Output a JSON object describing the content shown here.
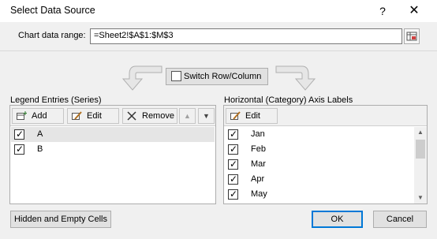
{
  "dialog": {
    "title": "Select Data Source",
    "help_glyph": "?",
    "close_glyph": "✕",
    "chart_range_label": "Chart data range:",
    "chart_range_value": "=Sheet2!$A$1:$M$3",
    "switch_label": "Switch Row/Column",
    "legend": {
      "label": "Legend Entries (Series)",
      "add_label": "Add",
      "edit_label": "Edit",
      "remove_label": "Remove",
      "up_glyph": "▲",
      "down_glyph": "▼",
      "series": [
        "A",
        "B"
      ]
    },
    "axis": {
      "label": "Horizontal (Category) Axis Labels",
      "edit_label": "Edit",
      "items": [
        "Jan",
        "Feb",
        "Mar",
        "Apr",
        "May"
      ]
    },
    "hidden_cells_label": "Hidden and Empty Cells",
    "ok_label": "OK",
    "cancel_label": "Cancel"
  },
  "colors": {
    "accent": "#0078d7",
    "selection": "#e5e5e5"
  }
}
